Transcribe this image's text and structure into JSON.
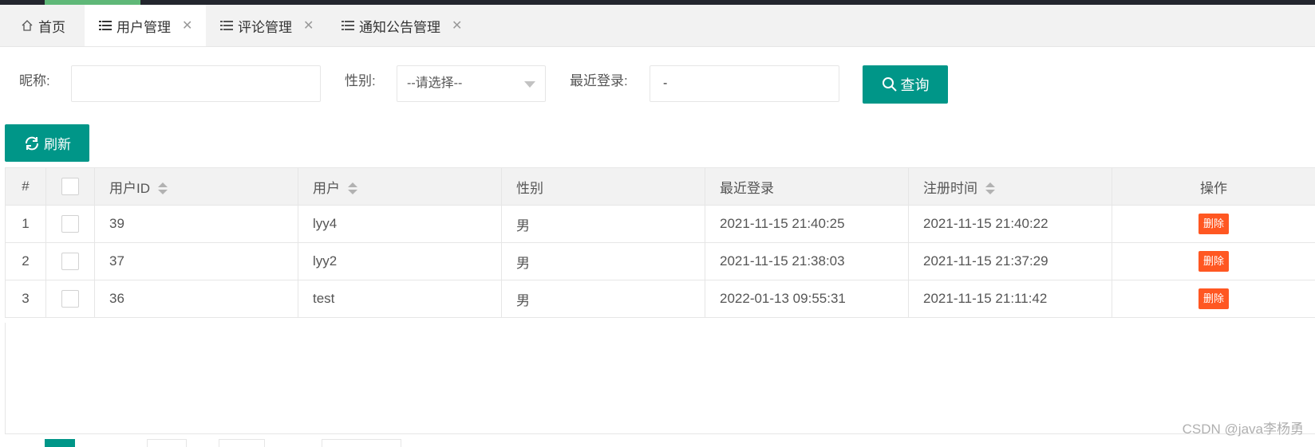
{
  "tabs": [
    {
      "label": "首页",
      "icon": "home-icon",
      "active": false
    },
    {
      "label": "用户管理",
      "icon": "list-icon",
      "active": true
    },
    {
      "label": "评论管理",
      "icon": "list-icon",
      "active": false
    },
    {
      "label": "通知公告管理",
      "icon": "list-icon",
      "active": false
    }
  ],
  "close_symbol": "✕",
  "search": {
    "nickname_label": "昵称:",
    "nickname_value": "",
    "gender_label": "性别:",
    "gender_selected": "--请选择--",
    "last_login_label": "最近登录:",
    "last_login_value": "-",
    "query_button": "查询"
  },
  "toolbar": {
    "refresh_button": "刷新"
  },
  "table": {
    "headers": {
      "index": "#",
      "user_id": "用户ID",
      "user": "用户",
      "gender": "性别",
      "last_login": "最近登录",
      "register_time": "注册时间",
      "actions": "操作"
    },
    "rows": [
      {
        "index": "1",
        "user_id": "39",
        "user": "lyy4",
        "gender": "男",
        "last_login": "2021-11-15 21:40:25",
        "register_time": "2021-11-15 21:40:22",
        "action": "删除"
      },
      {
        "index": "2",
        "user_id": "37",
        "user": "lyy2",
        "gender": "男",
        "last_login": "2021-11-15 21:38:03",
        "register_time": "2021-11-15 21:37:29",
        "action": "删除"
      },
      {
        "index": "3",
        "user_id": "36",
        "user": "test",
        "gender": "男",
        "last_login": "2022-01-13 09:55:31",
        "register_time": "2021-11-15 21:11:42",
        "action": "删除"
      }
    ]
  },
  "colors": {
    "primary": "#009688",
    "danger": "#ff5722",
    "accent": "#5fb878"
  },
  "watermark": "CSDN @java李杨勇"
}
